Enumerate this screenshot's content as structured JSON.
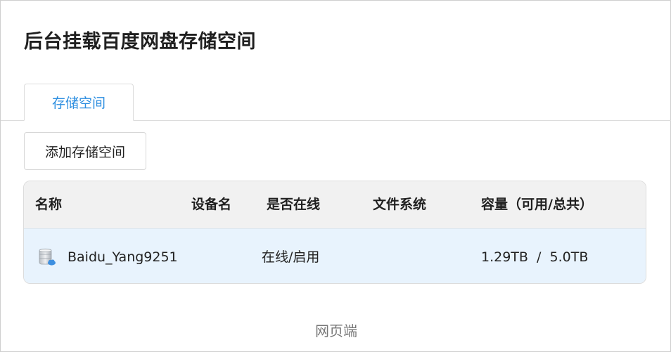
{
  "page": {
    "title": "后台挂载百度网盘存储空间",
    "footer_label": "网页端"
  },
  "tabs": [
    {
      "label": "存储空间",
      "active": true
    }
  ],
  "toolbar": {
    "add_button_label": "添加存储空间"
  },
  "table": {
    "columns": [
      "名称",
      "设备名",
      "是否在线",
      "文件系统",
      "容量（可用/总共）"
    ],
    "rows": [
      {
        "icon": "cloud-disk-icon",
        "name": "Baidu_Yang9251",
        "device": "",
        "status": "在线/启用",
        "filesystem": "",
        "capacity": "1.29TB  /  5.0TB"
      }
    ]
  },
  "colors": {
    "accent": "#2c8ee0",
    "row_selected_bg": "#e8f3fd",
    "header_bg": "#f1f1f1"
  }
}
